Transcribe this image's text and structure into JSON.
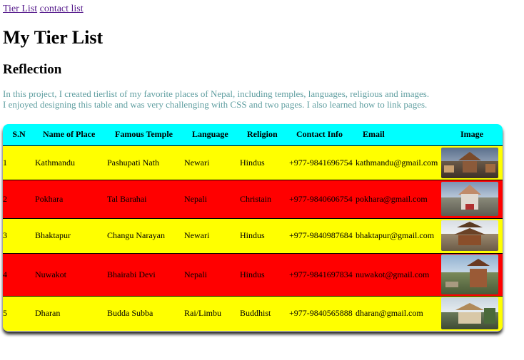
{
  "nav": {
    "links": [
      "Tier List",
      "contact list"
    ]
  },
  "page": {
    "title": "My Tier List",
    "subtitle": "Reflection",
    "reflection_lines": [
      "In this project, I created tierlist of my favorite places of Nepal, including temples, languages, religious and images.",
      "I enjoyed designing this table and was very challenging with CSS and two pages. I also learned how to link pages."
    ]
  },
  "table": {
    "headers": [
      "S.N",
      "Name of Place",
      "Famous Temple",
      "Language",
      "Religion",
      "Contact Info",
      "Email",
      "Image"
    ],
    "rows": [
      {
        "sn": "1",
        "place": "Kathmandu",
        "temple": "Pashupati Nath",
        "language": "Newari",
        "religion": "Hindus",
        "contact": "+977-9841696754",
        "email": "kathmandu@gmail.com",
        "image": "kathmandu-temple-photo"
      },
      {
        "sn": "2",
        "place": "Pokhara",
        "temple": "Tal Barahai",
        "language": "Nepali",
        "religion": "Christain",
        "contact": "+977-9840606754",
        "email": "pokhara@gmail.com",
        "image": "pokhara-temple-photo"
      },
      {
        "sn": "3",
        "place": "Bhaktapur",
        "temple": "Changu Narayan",
        "language": "Newari",
        "religion": "Hindus",
        "contact": "+977-9840987684",
        "email": "bhaktapur@gmail.com",
        "image": "bhaktapur-temple-photo"
      },
      {
        "sn": "4",
        "place": "Nuwakot",
        "temple": "Bhairabi Devi",
        "language": "Nepali",
        "religion": "Hindus",
        "contact": "+977-9841697834",
        "email": "nuwakot@gmail.com",
        "image": "nuwakot-temple-photo"
      },
      {
        "sn": "5",
        "place": "Dharan",
        "temple": "Budda Subba",
        "language": "Rai/Limbu",
        "religion": "Buddhist",
        "contact": "+977-9840565888",
        "email": "dharan@gmail.com",
        "image": "dharan-temple-photo"
      }
    ]
  },
  "colors": {
    "header_bg": "#00ffff",
    "row_odd": "#ffff00",
    "row_even": "#ff0000",
    "reflection_text": "#5f9ea0",
    "link": "#551a8b"
  }
}
